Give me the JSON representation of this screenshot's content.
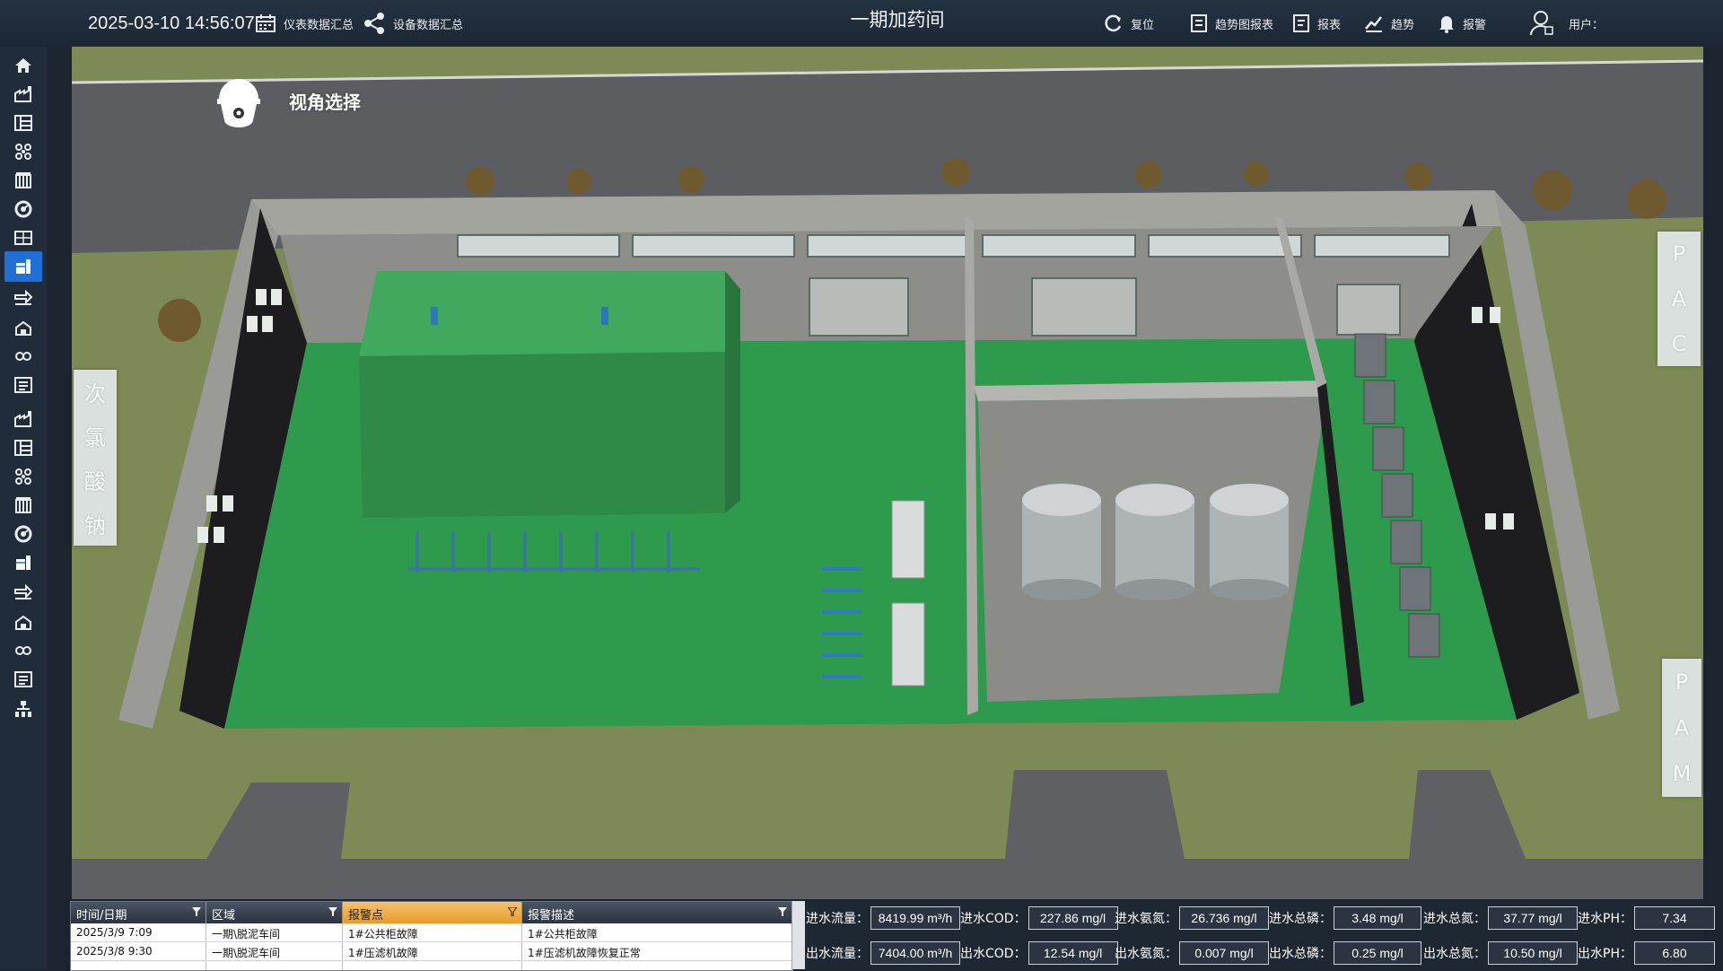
{
  "header": {
    "datetime": "2025-03-10 14:56:07",
    "title": "一期加药间",
    "nav_left": [
      {
        "label": "仪表数据汇总",
        "icon": "calendar-icon"
      },
      {
        "label": "设备数据汇总",
        "icon": "share-icon"
      }
    ],
    "nav_right": [
      {
        "label": "复位",
        "icon": "reset-icon"
      },
      {
        "label": "趋势图报表",
        "icon": "report-chart-icon"
      },
      {
        "label": "报表",
        "icon": "report-icon"
      },
      {
        "label": "趋势",
        "icon": "trend-icon"
      },
      {
        "label": "报警",
        "icon": "bell-icon"
      }
    ],
    "user_label": "用户："
  },
  "sidebar": {
    "active_index": 7,
    "items": [
      {
        "icon": "home-icon"
      },
      {
        "icon": "factory-icon"
      },
      {
        "icon": "layout-icon"
      },
      {
        "icon": "network-icon"
      },
      {
        "icon": "building-icon"
      },
      {
        "icon": "gauge-icon"
      },
      {
        "icon": "panel-icon"
      },
      {
        "icon": "dosing-icon"
      },
      {
        "icon": "pipeline-icon"
      },
      {
        "icon": "station-icon"
      },
      {
        "icon": "link-icon"
      },
      {
        "icon": "list-icon"
      },
      {
        "icon": "factory-icon"
      },
      {
        "icon": "layout-icon"
      },
      {
        "icon": "network-icon"
      },
      {
        "icon": "building-icon"
      },
      {
        "icon": "gauge-icon"
      },
      {
        "icon": "dosing-icon"
      },
      {
        "icon": "pipeline-icon"
      },
      {
        "icon": "station-icon"
      },
      {
        "icon": "link-icon"
      },
      {
        "icon": "list-icon"
      },
      {
        "icon": "org-chart-icon"
      }
    ]
  },
  "scene": {
    "view_select_label": "视角选择",
    "left_tab": [
      "次",
      "氯",
      "酸",
      "钠"
    ],
    "right_tab_top": [
      "P",
      "A",
      "C"
    ],
    "right_tab_bottom": [
      "P",
      "A",
      "M"
    ],
    "colors": {
      "floor": "#2e9a4d",
      "wall": "#9a9a97",
      "grass": "#7d8a55",
      "road": "#5b5d60"
    }
  },
  "alarm_table": {
    "headers": [
      "时间/日期",
      "区域",
      "报警点",
      "报警描述"
    ],
    "rows": [
      [
        "2025/3/9 7:09",
        "一期\\脱泥车间",
        "1#公共柜故障",
        "1#公共柜故障"
      ],
      [
        "2025/3/8 9:30",
        "一期\\脱泥车间",
        "1#压滤机故障",
        "1#压滤机故障恢复正常"
      ]
    ]
  },
  "metrics": {
    "inflow": [
      {
        "label": "进水流量：",
        "value": "8419.99 m³/h"
      },
      {
        "label": "进水COD：",
        "value": "227.86  mg/l"
      },
      {
        "label": "进水氨氮：",
        "value": "26.736  mg/l"
      },
      {
        "label": "进水总磷：",
        "value": "3.48  mg/l"
      },
      {
        "label": "进水总氮：",
        "value": "37.77  mg/l"
      },
      {
        "label": "进水PH：",
        "value": "7.34"
      }
    ],
    "outflow": [
      {
        "label": "出水流量：",
        "value": "7404.00 m³/h"
      },
      {
        "label": "出水COD：",
        "value": "12.54 mg/l"
      },
      {
        "label": "出水氨氮：",
        "value": "0.007  mg/l"
      },
      {
        "label": "出水总磷：",
        "value": "0.25  mg/l"
      },
      {
        "label": "出水总氮：",
        "value": "10.50  mg/l"
      },
      {
        "label": "出水PH：",
        "value": "6.80"
      }
    ]
  }
}
